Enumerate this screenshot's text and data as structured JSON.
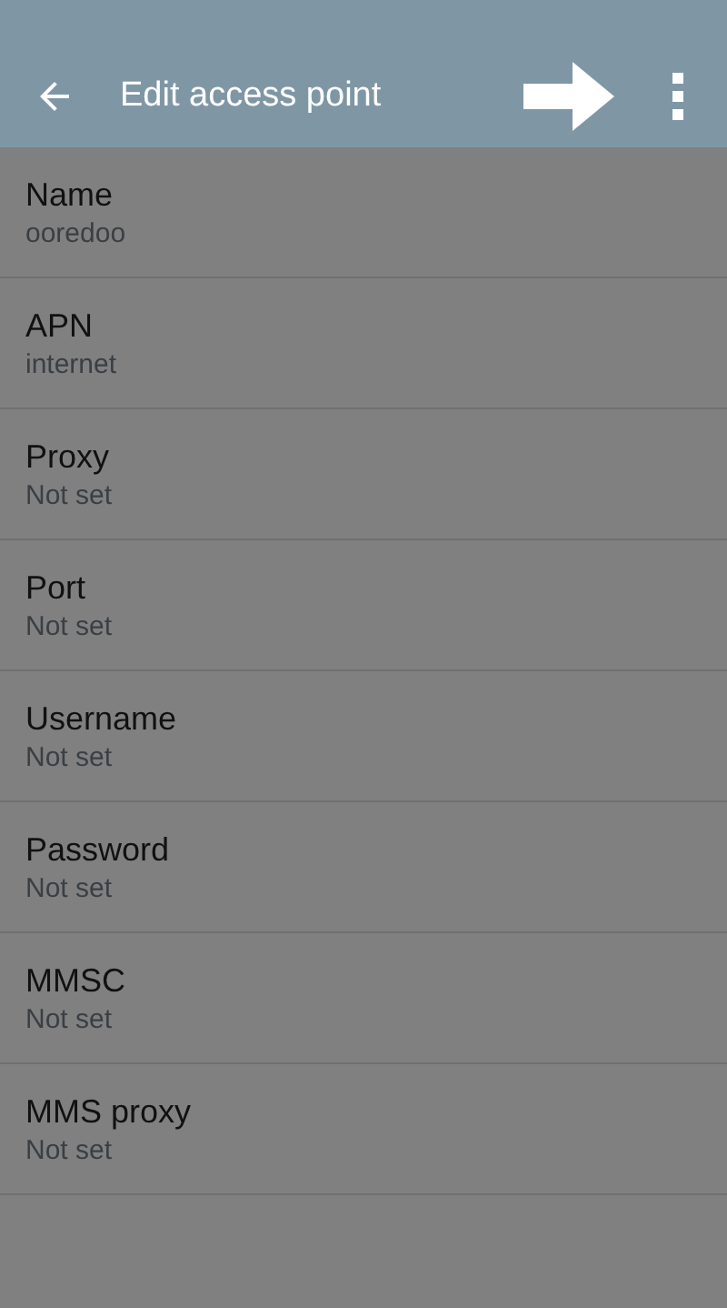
{
  "app_bar": {
    "title": "Edit access point"
  },
  "settings": [
    {
      "label": "Name",
      "value": "ooredoo"
    },
    {
      "label": "APN",
      "value": "internet"
    },
    {
      "label": "Proxy",
      "value": "Not set"
    },
    {
      "label": "Port",
      "value": "Not set"
    },
    {
      "label": "Username",
      "value": "Not set"
    },
    {
      "label": "Password",
      "value": "Not set"
    },
    {
      "label": "MMSC",
      "value": "Not set"
    },
    {
      "label": "MMS proxy",
      "value": "Not set"
    }
  ]
}
